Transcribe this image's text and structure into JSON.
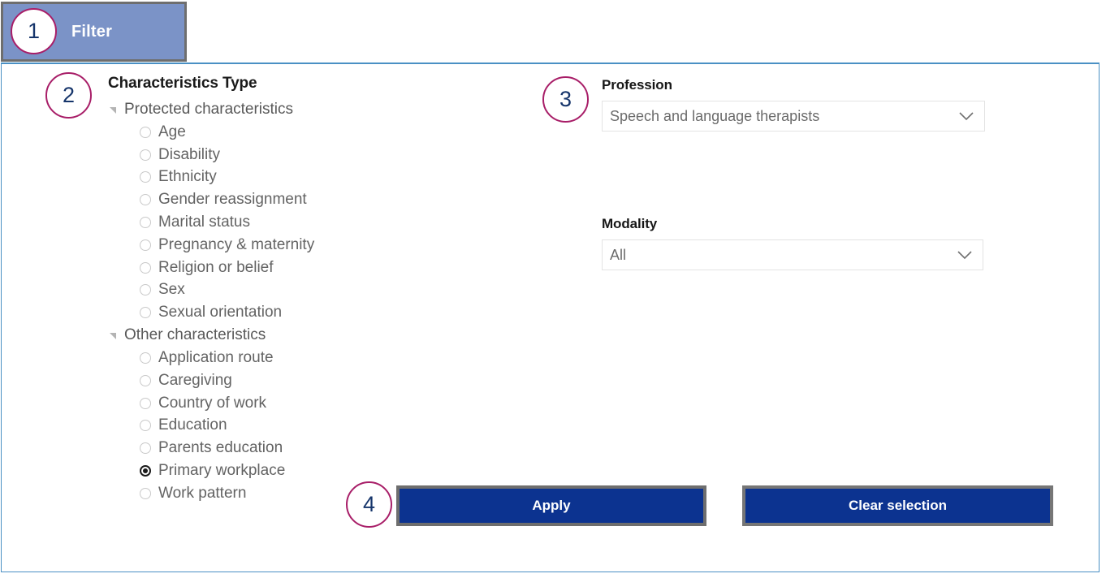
{
  "tab": {
    "label": "Filter"
  },
  "characteristics": {
    "title": "Characteristics Type",
    "groups": [
      {
        "label": "Protected characteristics",
        "expanded": true,
        "items": [
          {
            "label": "Age",
            "selected": false
          },
          {
            "label": "Disability",
            "selected": false
          },
          {
            "label": "Ethnicity",
            "selected": false
          },
          {
            "label": "Gender reassignment",
            "selected": false
          },
          {
            "label": "Marital status",
            "selected": false
          },
          {
            "label": "Pregnancy & maternity",
            "selected": false
          },
          {
            "label": "Religion or belief",
            "selected": false
          },
          {
            "label": "Sex",
            "selected": false
          },
          {
            "label": "Sexual orientation",
            "selected": false
          }
        ]
      },
      {
        "label": "Other characteristics",
        "expanded": true,
        "items": [
          {
            "label": "Application route",
            "selected": false
          },
          {
            "label": "Caregiving",
            "selected": false
          },
          {
            "label": "Country of work",
            "selected": false
          },
          {
            "label": "Education",
            "selected": false
          },
          {
            "label": "Parents education",
            "selected": false
          },
          {
            "label": "Primary workplace",
            "selected": true
          },
          {
            "label": "Work pattern",
            "selected": false
          }
        ]
      }
    ]
  },
  "profession": {
    "label": "Profession",
    "value": "Speech and language therapists"
  },
  "modality": {
    "label": "Modality",
    "value": "All"
  },
  "buttons": {
    "apply": "Apply",
    "clear": "Clear selection"
  },
  "annotations": {
    "one": "1",
    "two": "2",
    "three": "3",
    "four": "4"
  },
  "colors": {
    "tab_background": "#7b93c7",
    "tab_border": "#6e6e6e",
    "panel_border": "#4a90c4",
    "button_background": "#0c3390",
    "button_border": "#6e6e6e",
    "annotation_ring": "#a81e68",
    "annotation_text": "#16356b",
    "tree_text": "#636363",
    "heading_text": "#1a1a1a"
  }
}
